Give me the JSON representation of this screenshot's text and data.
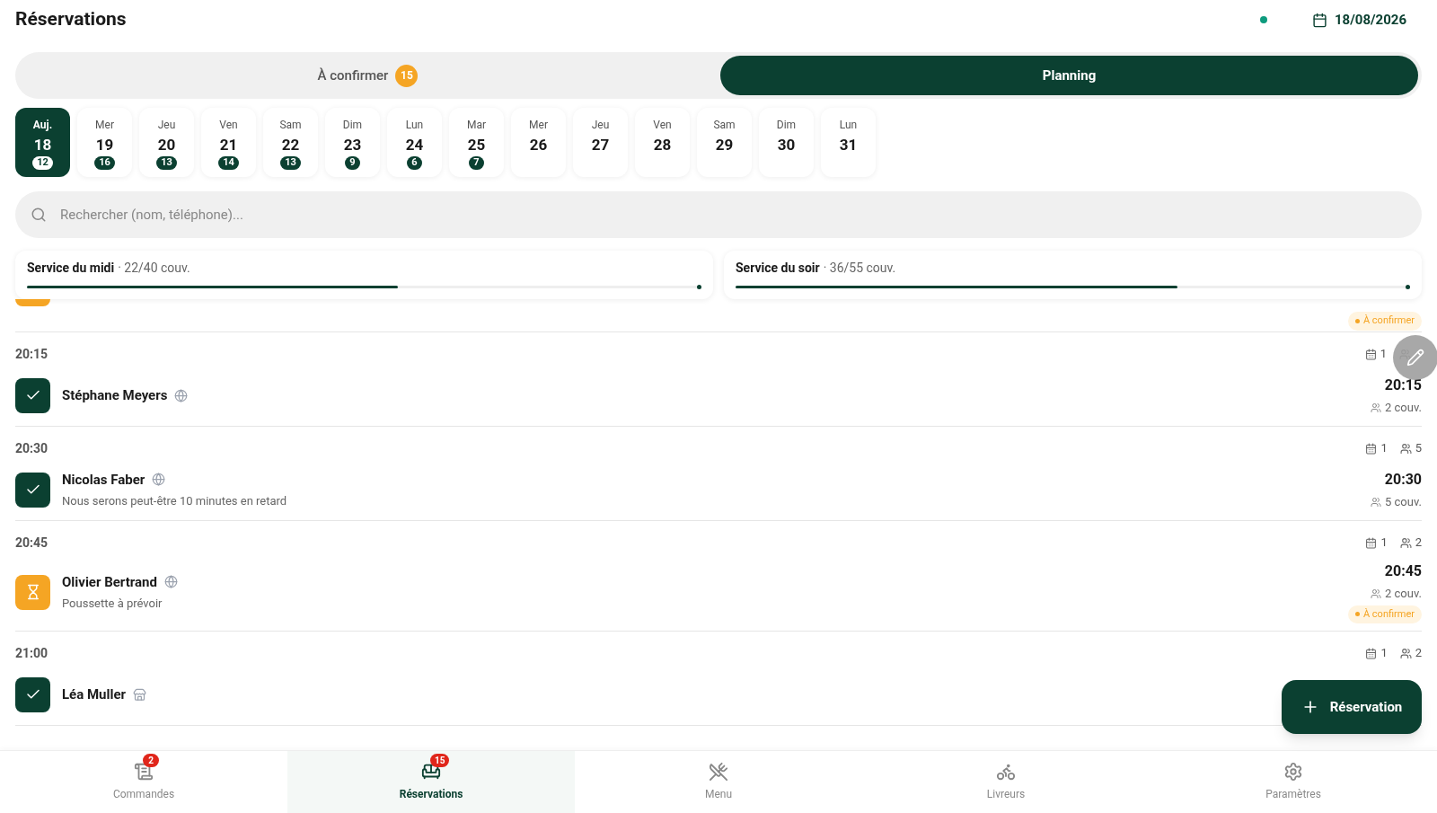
{
  "header": {
    "title": "Réservations",
    "online": true,
    "date": "18/08/2026"
  },
  "tabs": [
    {
      "label": "À confirmer",
      "count": "15",
      "selected": false
    },
    {
      "label": "Planning",
      "selected": true
    }
  ],
  "days": [
    {
      "weekday": "Auj.",
      "day": "18",
      "count": "12",
      "selected": true
    },
    {
      "weekday": "Mer",
      "day": "19",
      "count": "16",
      "selected": false
    },
    {
      "weekday": "Jeu",
      "day": "20",
      "count": "13",
      "selected": false
    },
    {
      "weekday": "Ven",
      "day": "21",
      "count": "14",
      "selected": false
    },
    {
      "weekday": "Sam",
      "day": "22",
      "count": "13",
      "selected": false
    },
    {
      "weekday": "Dim",
      "day": "23",
      "count": "9",
      "selected": false
    },
    {
      "weekday": "Lun",
      "day": "24",
      "count": "6",
      "selected": false
    },
    {
      "weekday": "Mar",
      "day": "25",
      "count": "7",
      "selected": false
    },
    {
      "weekday": "Mer",
      "day": "26",
      "selected": false
    },
    {
      "weekday": "Jeu",
      "day": "27",
      "selected": false
    },
    {
      "weekday": "Ven",
      "day": "28",
      "selected": false
    },
    {
      "weekday": "Sam",
      "day": "29",
      "selected": false
    },
    {
      "weekday": "Dim",
      "day": "30",
      "selected": false
    },
    {
      "weekday": "Lun",
      "day": "31",
      "selected": false
    }
  ],
  "search": {
    "placeholder": "Rechercher (nom, téléphone)..."
  },
  "services": [
    {
      "name": "Service du midi",
      "covers": "· 22/40 couv.",
      "level": 0.55
    },
    {
      "name": "Service du soir",
      "covers": "· 36/55 couv.",
      "level": 0.655
    }
  ],
  "partial_row": {
    "confirmed": false,
    "badge": "À confirmer"
  },
  "groups": [
    {
      "time": "20:15",
      "tables": "1",
      "reservations": [
        {
          "name": "Stéphane Meyers",
          "online": true,
          "confirmed": true,
          "time": "20:15",
          "covers": "2 couv."
        }
      ]
    },
    {
      "time": "20:30",
      "tables": "1",
      "guests": "5",
      "reservations": [
        {
          "name": "Nicolas Faber",
          "online": true,
          "confirmed": true,
          "note": "Nous serons peut-être 10 minutes en retard",
          "time": "20:30",
          "covers": "5 couv."
        }
      ]
    },
    {
      "time": "20:45",
      "tables": "1",
      "guests": "2",
      "reservations": [
        {
          "name": "Olivier Bertrand",
          "online": true,
          "confirmed": false,
          "note": "Poussette à prévoir",
          "time": "20:45",
          "covers": "2 couv.",
          "badge": "À confirmer"
        }
      ]
    },
    {
      "time": "21:00",
      "tables": "1",
      "guests": "2",
      "reservations": [
        {
          "name": "Léa Muller",
          "online": false,
          "confirmed": true
        }
      ]
    }
  ],
  "fab": {
    "label": "Réservation"
  },
  "nav": [
    {
      "kind": "orders",
      "label": "Commandes",
      "badge": "2",
      "selected": false
    },
    {
      "kind": "reservations",
      "label": "Réservations",
      "badge": "15",
      "selected": true
    },
    {
      "kind": "menu",
      "label": "Menu",
      "selected": false
    },
    {
      "kind": "couriers",
      "label": "Livreurs",
      "selected": false
    },
    {
      "kind": "settings",
      "label": "Paramètres",
      "selected": false
    }
  ]
}
